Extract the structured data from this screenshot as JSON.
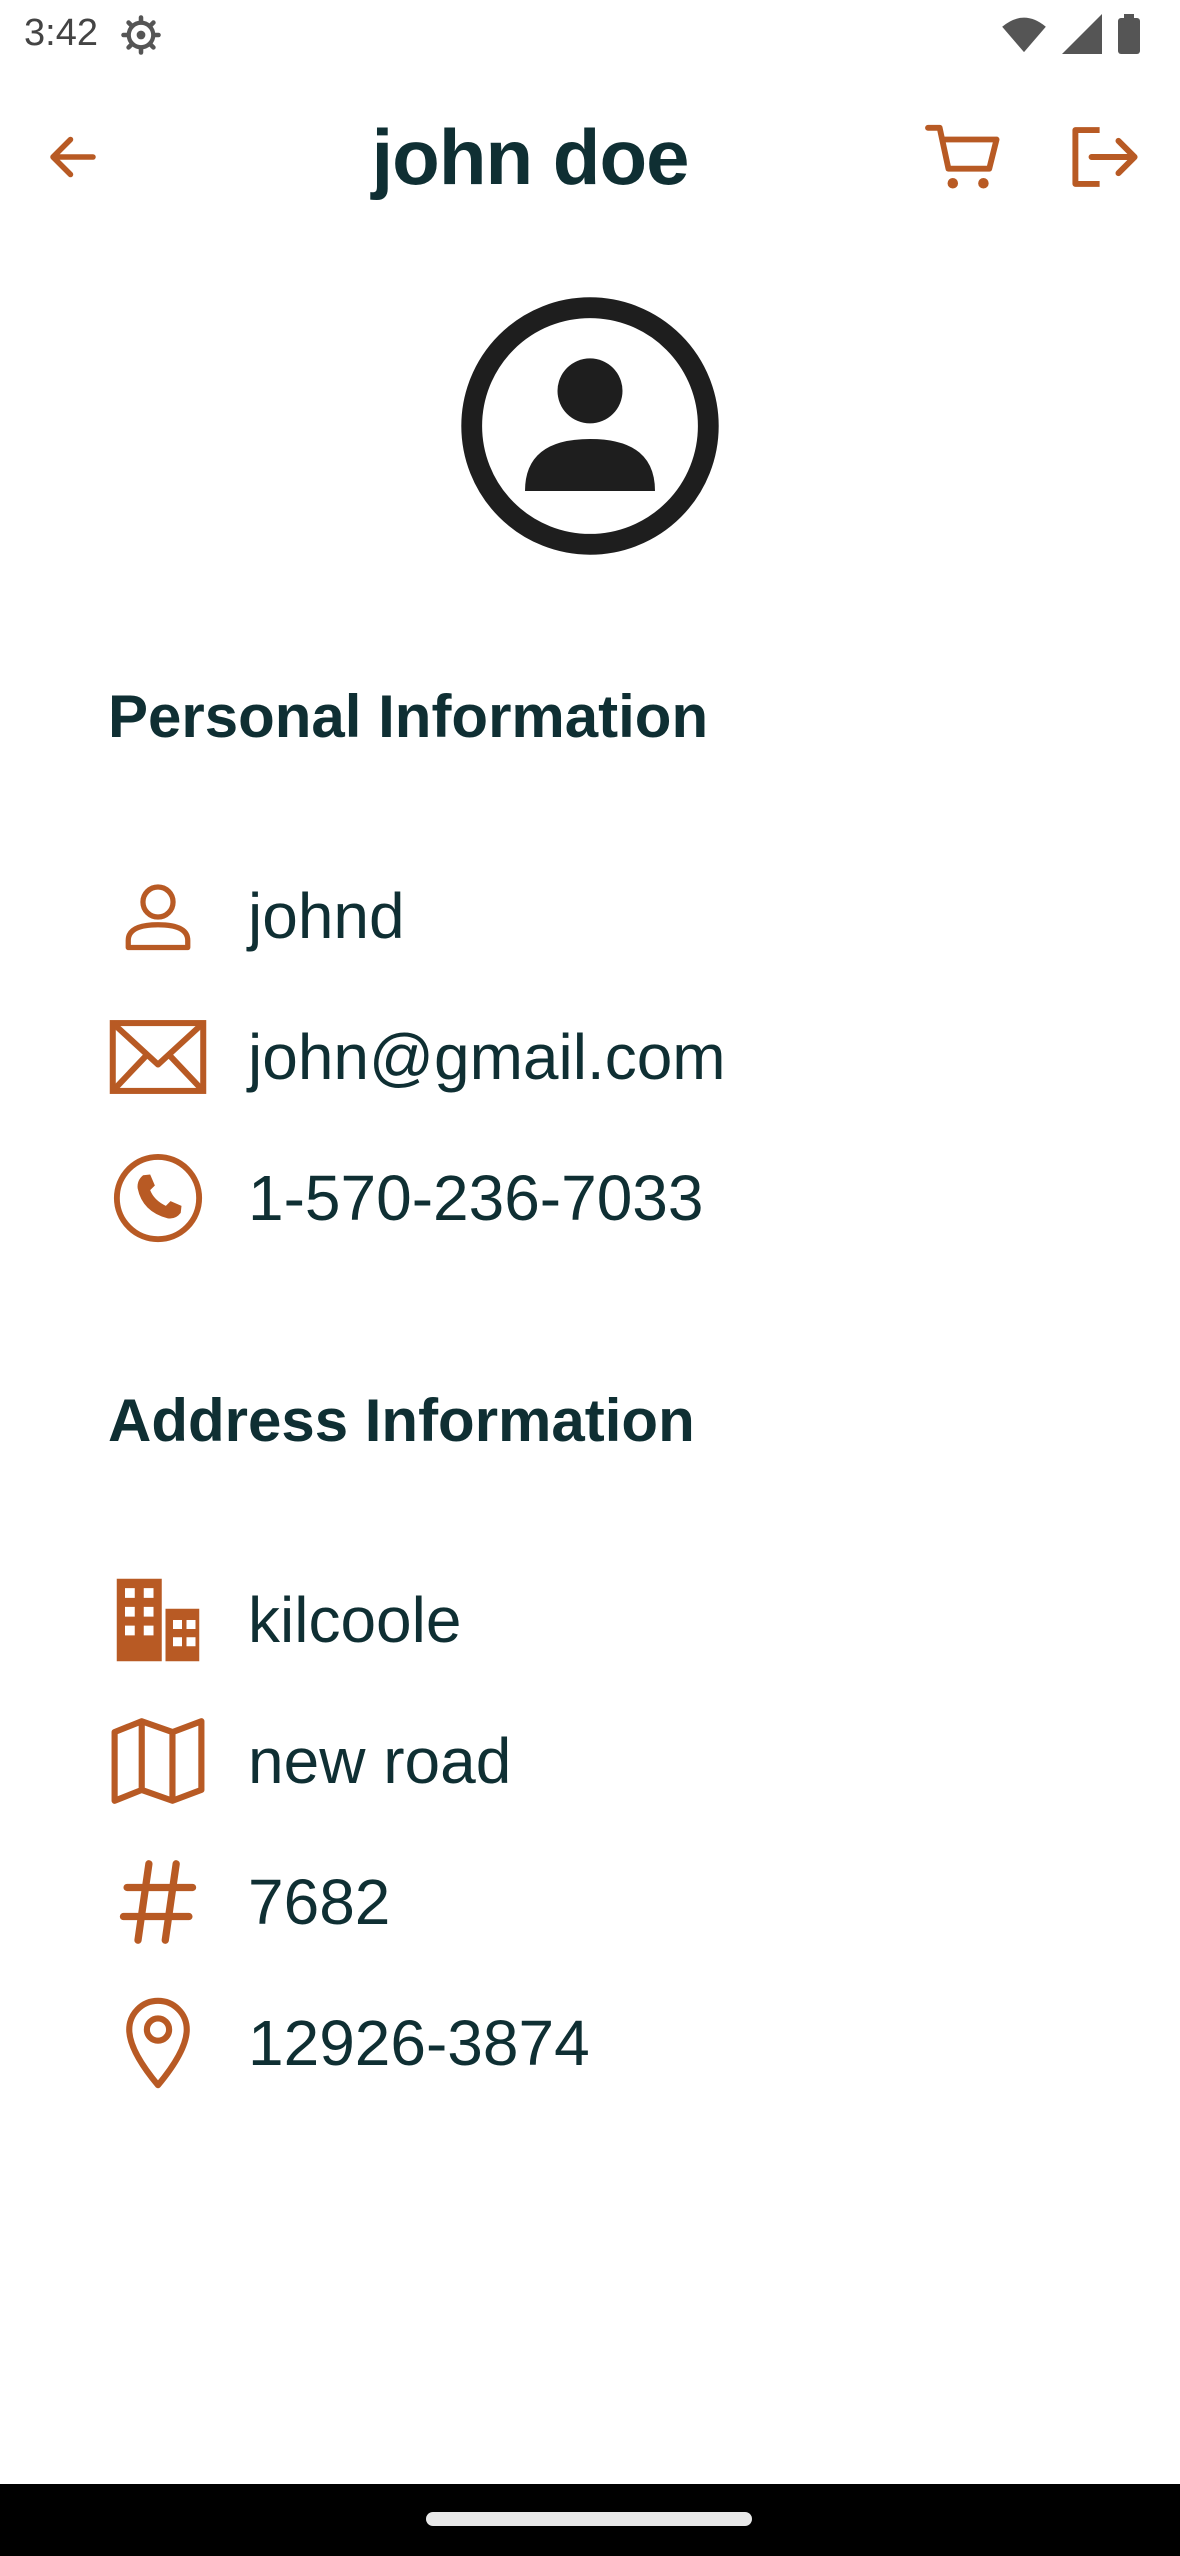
{
  "status_bar": {
    "time": "3:42"
  },
  "header": {
    "title": "john doe"
  },
  "sections": {
    "personal": {
      "title": "Personal Information",
      "username": "johnd",
      "email": "john@gmail.com",
      "phone": "1-570-236-7033"
    },
    "address": {
      "title": "Address Information",
      "city": "kilcoole",
      "street": "new road",
      "number": "7682",
      "zipcode": "12926-3874"
    }
  },
  "icons": {
    "back": "arrow-left-icon",
    "cart": "cart-icon",
    "logout": "logout-icon",
    "avatar": "account-circle-icon",
    "username": "person-icon",
    "email": "mail-icon",
    "phone": "phone-icon",
    "city": "building-icon",
    "street": "map-icon",
    "number": "hash-icon",
    "zipcode": "location-pin-icon"
  },
  "colors": {
    "accent": "#b85a24",
    "text": "#0f2f33",
    "avatar": "#1e1e1e"
  }
}
